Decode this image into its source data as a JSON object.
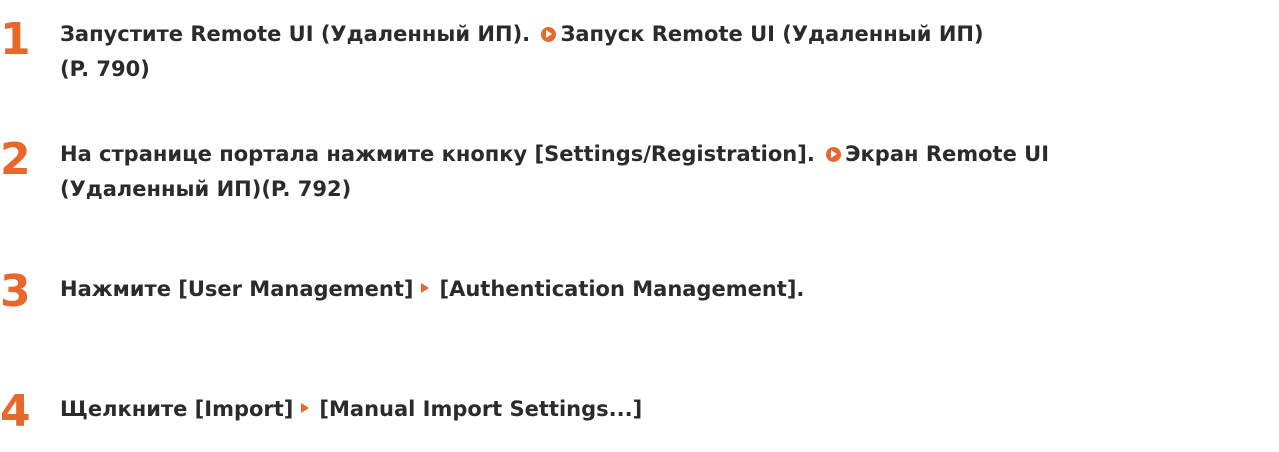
{
  "steps": [
    {
      "number": "1",
      "text": "Запустите Remote UI (Удаленный ИП). ",
      "link_line1": "Запуск Remote UI (Удаленный ИП)",
      "link_line2": "(P. 790)"
    },
    {
      "number": "2",
      "text": "На странице портала нажмите кнопку [Settings/Registration]. ",
      "link_line1": "Экран Remote UI",
      "link_line2": "(Удаленный ИП)(P. 792)"
    },
    {
      "number": "3",
      "part1": "Нажмите [User Management]",
      "part2": "[Authentication Management]."
    },
    {
      "number": "4",
      "part1": "Щелкните [Import]",
      "part2": "[Manual Import Settings...]"
    }
  ],
  "colors": {
    "accent": "#e8672a",
    "text": "#2b2b2b"
  },
  "icons": {
    "link": "circle-play-icon",
    "menu_separator": "triangle-right-icon"
  }
}
